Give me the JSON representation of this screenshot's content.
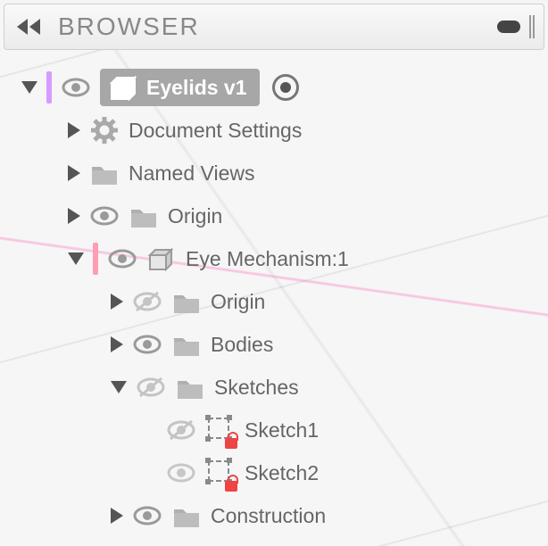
{
  "header": {
    "title": "BROWSER"
  },
  "tree": {
    "root": {
      "label": "Eyelids v1",
      "selected": true,
      "children": {
        "docSettings": {
          "label": "Document Settings"
        },
        "namedViews": {
          "label": "Named Views"
        },
        "origin": {
          "label": "Origin"
        },
        "eyeMech": {
          "label": "Eye Mechanism:1",
          "children": {
            "origin": {
              "label": "Origin"
            },
            "bodies": {
              "label": "Bodies"
            },
            "sketches": {
              "label": "Sketches",
              "children": {
                "s1": {
                  "label": "Sketch1"
                },
                "s2": {
                  "label": "Sketch2"
                }
              }
            },
            "construction": {
              "label": "Construction"
            }
          }
        }
      }
    }
  }
}
